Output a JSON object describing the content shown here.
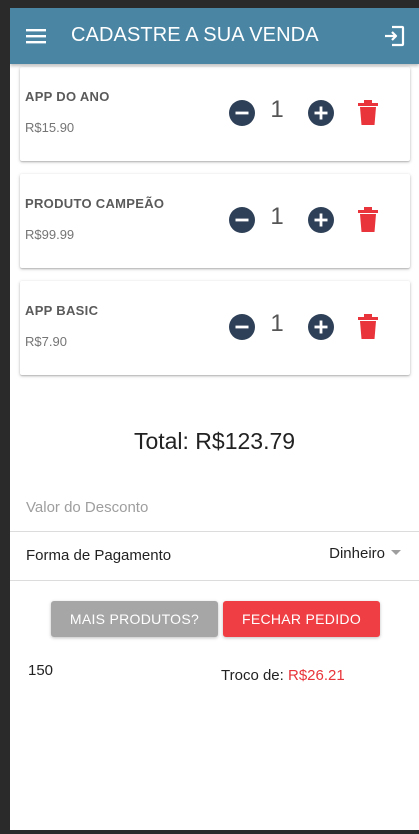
{
  "appbar": {
    "title": "CADASTRE A SUA VENDA",
    "menu_icon": "hamburger-menu-icon",
    "logout_icon": "logout-exit-icon"
  },
  "cart": {
    "items": [
      {
        "name": "APP DO ANO",
        "price": "R$15.90",
        "quantity": "1"
      },
      {
        "name": "PRODUTO CAMPEÃO",
        "price": "R$99.99",
        "quantity": "1"
      },
      {
        "name": "APP BASIC",
        "price": "R$7.90",
        "quantity": "1"
      }
    ]
  },
  "summary": {
    "total": "Total: R$123.79"
  },
  "discount": {
    "placeholder": "Valor do Desconto",
    "value": ""
  },
  "payment": {
    "label": "Forma de Pagamento",
    "selected": "Dinheiro"
  },
  "actions": {
    "more_products": "MAIS PRODUTOS?",
    "close_order": "FECHAR PEDIDO"
  },
  "cash": {
    "received": "150",
    "change_label": "Troco de: ",
    "change_value": "R$26.21"
  },
  "colors": {
    "appbar": "#4a86a4",
    "icon_dark": "#2e4057",
    "delete": "#e8343a",
    "button_gray": "#a6a6a6",
    "button_red": "#ef3f44"
  }
}
